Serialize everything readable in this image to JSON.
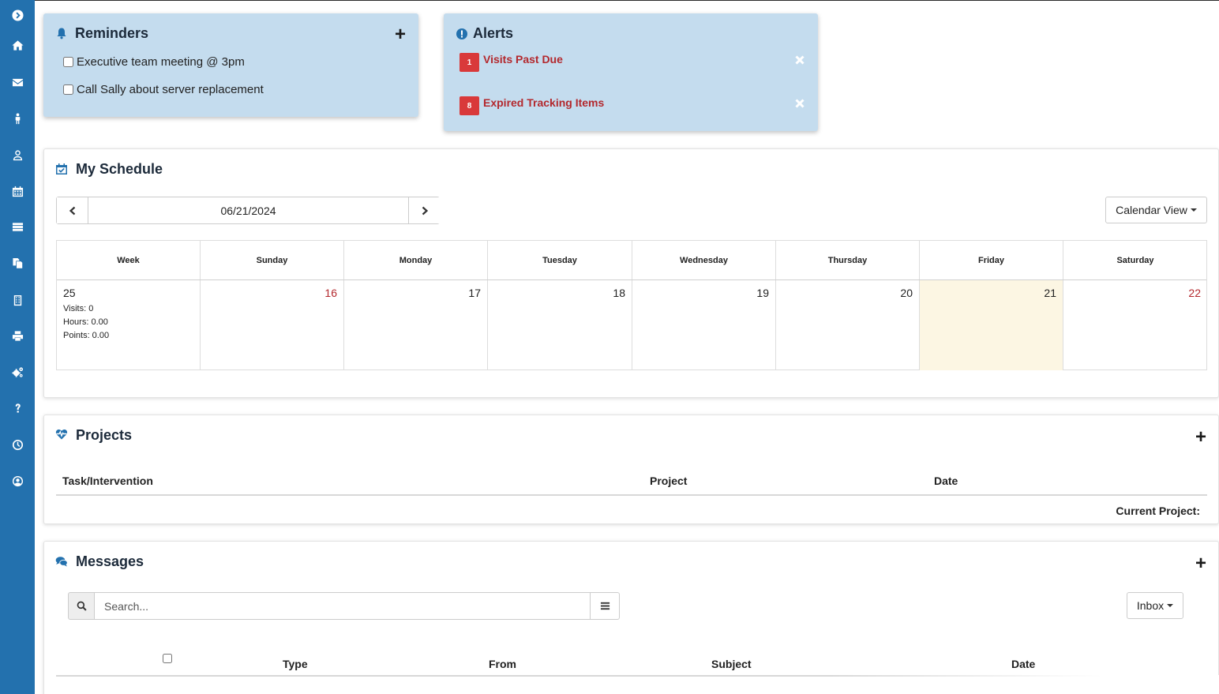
{
  "sidebar": {
    "items": [
      {
        "icon": "expand-icon"
      },
      {
        "icon": "home-icon"
      },
      {
        "icon": "envelope-icon"
      },
      {
        "icon": "person-icon"
      },
      {
        "icon": "user-icon"
      },
      {
        "icon": "calendar-icon"
      },
      {
        "icon": "list-icon"
      },
      {
        "icon": "files-icon"
      },
      {
        "icon": "building-icon"
      },
      {
        "icon": "print-icon"
      },
      {
        "icon": "cogs-icon"
      },
      {
        "icon": "question-icon"
      },
      {
        "icon": "clock-icon"
      },
      {
        "icon": "account-icon"
      }
    ]
  },
  "reminders": {
    "title": "Reminders",
    "add_label": "+",
    "items": [
      {
        "label": "Executive team meeting @ 3pm",
        "checked": false
      },
      {
        "label": "Call Sally about server replacement",
        "checked": false
      }
    ]
  },
  "alerts": {
    "title": "Alerts",
    "items": [
      {
        "count": "1",
        "label": "Visits Past Due"
      },
      {
        "count": "8",
        "label": "Expired Tracking Items"
      }
    ]
  },
  "schedule": {
    "title": "My Schedule",
    "date": "06/21/2024",
    "view_label": "Calendar View",
    "headers": [
      "Week",
      "Sunday",
      "Monday",
      "Tuesday",
      "Wednesday",
      "Thursday",
      "Friday",
      "Saturday"
    ],
    "week": {
      "number": "25",
      "visits": "Visits: 0",
      "hours": "Hours: 0.00",
      "points": "Points: 0.00"
    },
    "days": [
      "16",
      "17",
      "18",
      "19",
      "20",
      "21",
      "22"
    ],
    "today_color": "#fcf6e3",
    "weekend_color": "#b3282d"
  },
  "projects": {
    "title": "Projects",
    "add_label": "+",
    "columns": [
      "Task/Intervention",
      "Project",
      "Date"
    ],
    "footer": "Current Project:"
  },
  "messages": {
    "title": "Messages",
    "add_label": "+",
    "search_placeholder": "Search...",
    "folder_label": "Inbox",
    "columns": [
      "Type",
      "From",
      "Subject",
      "Date"
    ]
  },
  "colors": {
    "sidebar": "#2371ae",
    "card": "#c4dcee",
    "alert_badge": "#d9393a",
    "alert_text": "#b3282d"
  }
}
